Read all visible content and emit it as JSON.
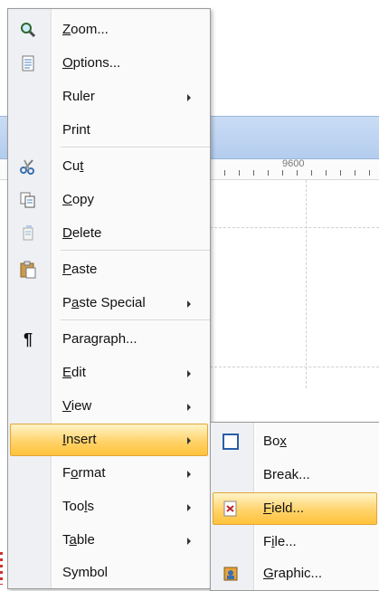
{
  "background": {
    "ruler_value": "9600"
  },
  "context_menu": {
    "items": [
      {
        "name": "zoom",
        "pre": "",
        "u": "Z",
        "post": "oom...",
        "icon": "zoom-magnifier-icon",
        "submenu": false
      },
      {
        "name": "options",
        "pre": "",
        "u": "O",
        "post": "ptions...",
        "icon": "options-document-icon",
        "submenu": false
      },
      {
        "name": "ruler",
        "pre": "Ruler",
        "u": "",
        "post": "",
        "icon": "",
        "submenu": true
      },
      {
        "name": "print",
        "pre": "Print",
        "u": "",
        "post": "",
        "icon": "",
        "submenu": false
      },
      {
        "name": "cut",
        "pre": "Cu",
        "u": "t",
        "post": "",
        "icon": "scissors-icon",
        "submenu": false
      },
      {
        "name": "copy",
        "pre": "",
        "u": "C",
        "post": "opy",
        "icon": "copy-icon",
        "submenu": false
      },
      {
        "name": "delete",
        "pre": "",
        "u": "D",
        "post": "elete",
        "icon": "delete-icon",
        "submenu": false
      },
      {
        "name": "paste",
        "pre": "",
        "u": "P",
        "post": "aste",
        "icon": "clipboard-paste-icon",
        "submenu": false
      },
      {
        "name": "paste-special",
        "pre": "P",
        "u": "a",
        "post": "ste Special",
        "icon": "",
        "submenu": true
      },
      {
        "name": "paragraph",
        "pre": "Paragraph...",
        "u": "",
        "post": "",
        "icon": "pilcrow-icon",
        "submenu": false
      },
      {
        "name": "edit",
        "pre": "",
        "u": "E",
        "post": "dit",
        "icon": "",
        "submenu": true
      },
      {
        "name": "view",
        "pre": "",
        "u": "V",
        "post": "iew",
        "icon": "",
        "submenu": true
      },
      {
        "name": "insert",
        "pre": "",
        "u": "I",
        "post": "nsert",
        "icon": "",
        "submenu": true,
        "highlighted": true
      },
      {
        "name": "format",
        "pre": "F",
        "u": "o",
        "post": "rmat",
        "icon": "",
        "submenu": true
      },
      {
        "name": "tools",
        "pre": "Too",
        "u": "l",
        "post": "s",
        "icon": "",
        "submenu": true
      },
      {
        "name": "table",
        "pre": "T",
        "u": "a",
        "post": "ble",
        "icon": "",
        "submenu": true
      },
      {
        "name": "symbol",
        "pre": "Symbol",
        "u": "",
        "post": "",
        "icon": "",
        "submenu": false
      }
    ]
  },
  "insert_submenu": {
    "items": [
      {
        "name": "box",
        "pre": "Bo",
        "u": "x",
        "post": "",
        "icon": "box-square-icon"
      },
      {
        "name": "break",
        "pre": "Break...",
        "u": "",
        "post": "",
        "icon": ""
      },
      {
        "name": "field",
        "pre": "",
        "u": "F",
        "post": "ield...",
        "icon": "field-icon",
        "highlighted": true
      },
      {
        "name": "file",
        "pre": "F",
        "u": "i",
        "post": "le...",
        "icon": ""
      },
      {
        "name": "graphic",
        "pre": "",
        "u": "G",
        "post": "raphic...",
        "icon": "graphic-image-icon"
      }
    ]
  }
}
